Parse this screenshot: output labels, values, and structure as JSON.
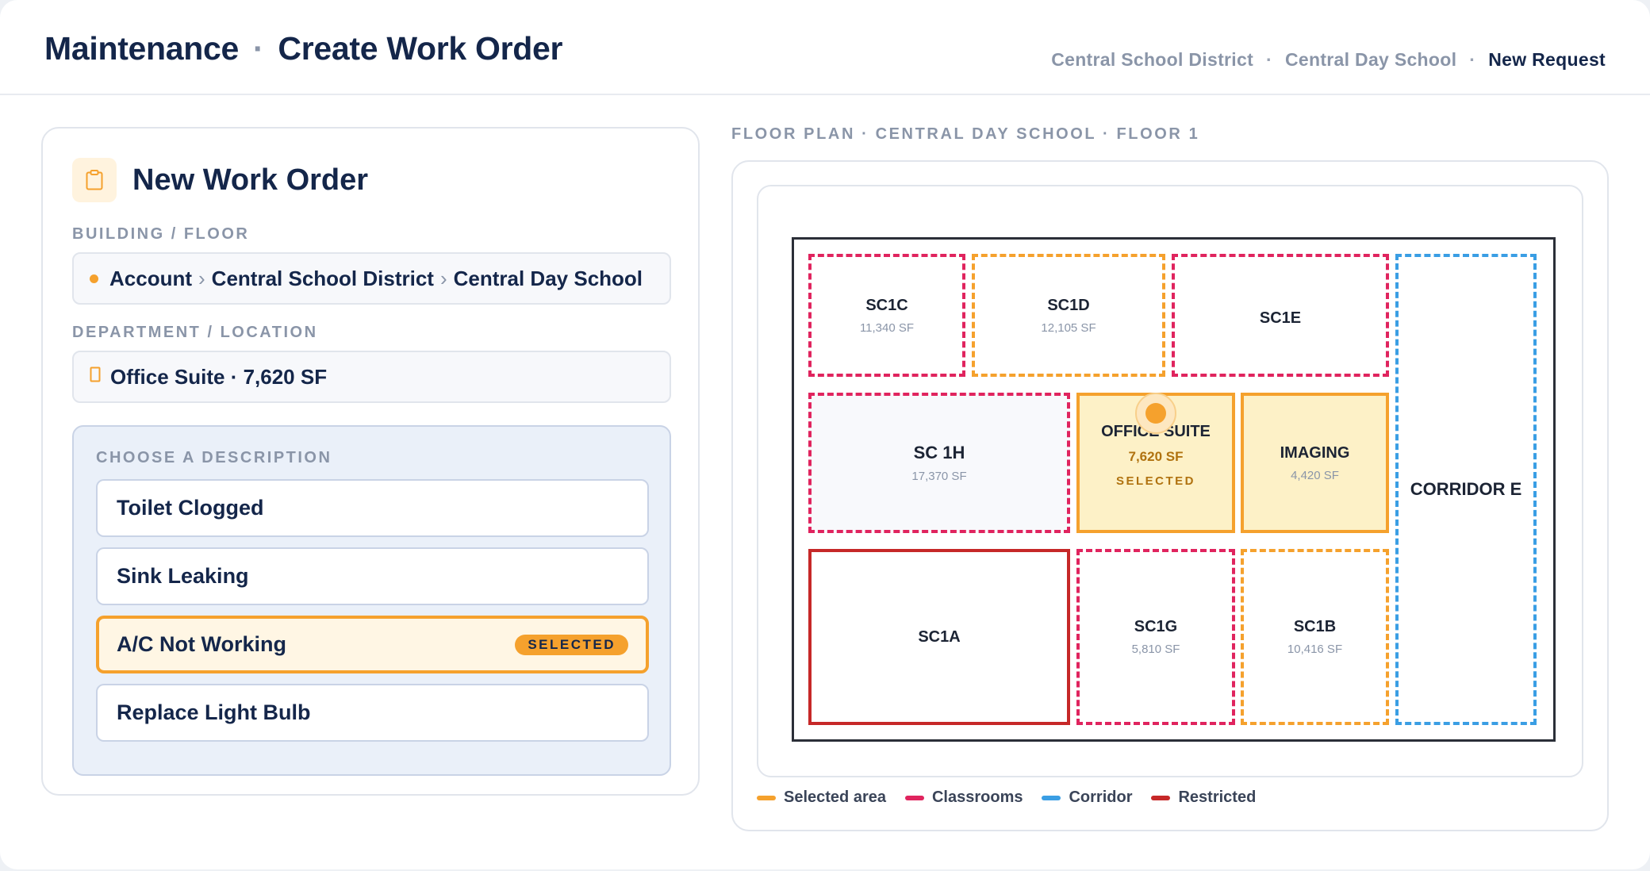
{
  "header": {
    "title_module": "Maintenance",
    "title_separator": "·",
    "title_page": "Create Work Order",
    "breadcrumb": [
      "Central School District",
      "Central Day School",
      "New Request"
    ],
    "breadcrumb_separator": "·"
  },
  "form": {
    "card_title": "New Work Order",
    "card_icon": "clipboard-icon",
    "building_label": "BUILDING / FLOOR",
    "building_path": [
      "Account",
      "Central School District",
      "Central Day School"
    ],
    "path_separator": "›",
    "department_label": "DEPARTMENT / LOCATION",
    "department_value": "Office Suite · 7,620 SF",
    "description_label": "CHOOSE A DESCRIPTION",
    "descriptions": [
      {
        "label": "Toilet Clogged",
        "selected": false
      },
      {
        "label": "Sink Leaking",
        "selected": false
      },
      {
        "label": "A/C Not Working",
        "selected": true
      },
      {
        "label": "Replace Light Bulb",
        "selected": false
      }
    ],
    "selected_badge": "SELECTED"
  },
  "floor_plan": {
    "caption": "FLOOR PLAN · CENTRAL DAY SCHOOL · FLOOR 1",
    "rooms": {
      "sc1c": {
        "name": "SC1C",
        "sf": "11,340 SF",
        "type": "classroom"
      },
      "sc1d": {
        "name": "SC1D",
        "sf": "12,105 SF",
        "type": "selected-area"
      },
      "sc1e": {
        "name": "SC1E",
        "type": "classroom"
      },
      "sc1h": {
        "name": "SC 1H",
        "sf": "17,370 SF",
        "type": "classroom"
      },
      "office": {
        "name": "OFFICE SUITE",
        "sf": "7,620 SF",
        "tag": "SELECTED",
        "type": "selected-area"
      },
      "imaging": {
        "name": "IMAGING",
        "sf": "4,420 SF",
        "type": "selected-area"
      },
      "sc1a": {
        "name": "SC1A",
        "type": "restricted"
      },
      "sc1g": {
        "name": "SC1G",
        "sf": "5,810 SF",
        "type": "classroom"
      },
      "sc1b": {
        "name": "SC1B",
        "sf": "10,416 SF",
        "type": "selected-area"
      },
      "corridor": {
        "name": "CORRIDOR E",
        "type": "corridor"
      }
    },
    "legend": [
      {
        "label": "Selected area",
        "color": "#f5a12d"
      },
      {
        "label": "Classrooms",
        "color": "#e0245e"
      },
      {
        "label": "Corridor",
        "color": "#3a9ee4"
      },
      {
        "label": "Restricted",
        "color": "#c62828"
      }
    ]
  },
  "colors": {
    "accent": "#f5a12d",
    "classroom": "#e0245e",
    "corridor": "#3a9ee4",
    "restricted": "#c62828",
    "heading": "#14264a"
  }
}
